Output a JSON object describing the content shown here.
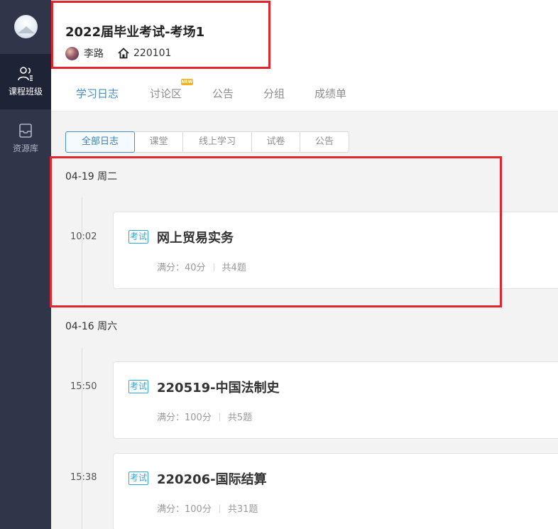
{
  "sidebar": {
    "items": [
      {
        "label": "课程班级",
        "icon": "class-icon",
        "active": true
      },
      {
        "label": "资源库",
        "icon": "library-icon",
        "active": false
      }
    ]
  },
  "header": {
    "course_title": "2022届毕业考试-考场1",
    "teacher": "李路",
    "class_code": "220101"
  },
  "tabs": [
    {
      "label": "学习日志",
      "active": true
    },
    {
      "label": "讨论区",
      "badge": "NEW"
    },
    {
      "label": "公告"
    },
    {
      "label": "分组"
    },
    {
      "label": "成绩单"
    }
  ],
  "filters": [
    {
      "label": "全部日志",
      "active": true
    },
    {
      "label": "课堂"
    },
    {
      "label": "线上学习"
    },
    {
      "label": "试卷"
    },
    {
      "label": "公告"
    }
  ],
  "groups": [
    {
      "date": "04-19 周二",
      "entries": [
        {
          "time": "10:02",
          "tag": "考试",
          "title": "网上贸易实务",
          "score": "满分：40分",
          "count": "共4题"
        }
      ]
    },
    {
      "date": "04-16 周六",
      "entries": [
        {
          "time": "15:50",
          "tag": "考试",
          "title": "220519-中国法制史",
          "score": "满分：100分",
          "count": "共5题"
        },
        {
          "time": "15:38",
          "tag": "考试",
          "title": "220206-国际结算",
          "score": "满分：100分",
          "count": "共31题"
        }
      ]
    }
  ],
  "colors": {
    "sidebar_bg": "#30354a",
    "accent": "#4b8cbd",
    "exam_tag": "#31a8d8",
    "annotation_red": "#e0252f"
  }
}
